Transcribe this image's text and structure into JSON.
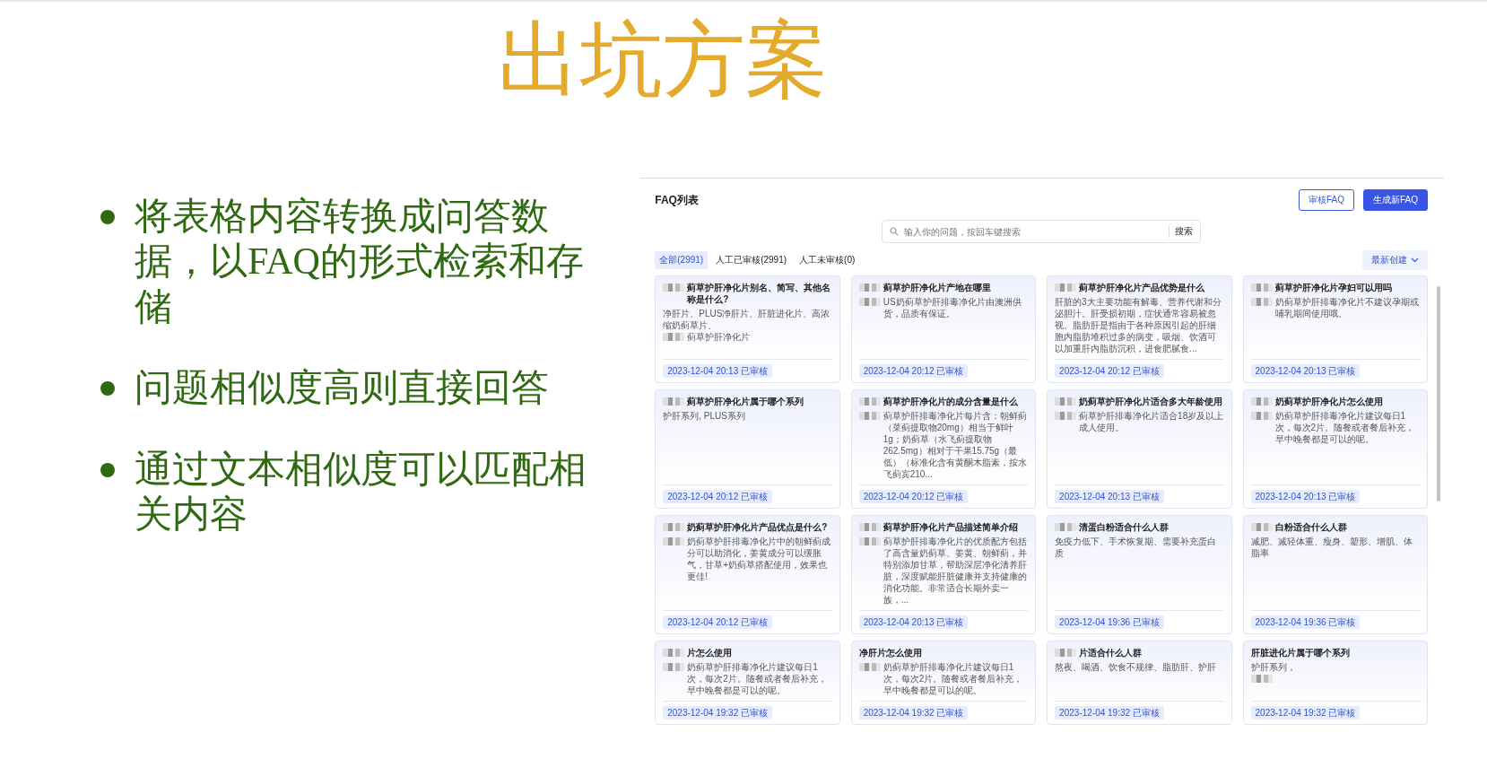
{
  "slide": {
    "title": "出坑方案",
    "bullets": [
      "将表格内容转换成问答数据，以FAQ的形式检索和存储",
      "问题相似度高则直接回答",
      "通过文本相似度可以匹配相关内容"
    ]
  },
  "faq_panel": {
    "title": "FAQ列表",
    "buttons": [
      {
        "label": "审核FAQ",
        "kind": "outline"
      },
      {
        "label": "生成新FAQ",
        "kind": "primary"
      }
    ],
    "search": {
      "placeholder": "输入你的问题，按回车键搜索",
      "button": "搜索"
    },
    "tabs": [
      {
        "label": "全部(2991)",
        "selected": true
      },
      {
        "label": "人工已审核(2991)",
        "selected": false
      },
      {
        "label": "人工未审核(0)",
        "selected": false
      }
    ],
    "sort": {
      "label": "最新创建"
    },
    "cards": [
      {
        "title": [
          {
            "redacted": true,
            "text": "蓟草护肝净化片别名、简写、其他名称是什么?"
          }
        ],
        "answer": [
          {
            "redacted": false,
            "text": "净肝片、PLUS净肝片、肝脏进化片、高浓缩奶蓟草片、"
          },
          {
            "redacted": true,
            "text": "蓟草护肝净化片"
          }
        ],
        "date": "2023-12-04 20:13",
        "status": "已审核"
      },
      {
        "title": [
          {
            "redacted": true,
            "text": "蓟草护肝净化片产地在哪里"
          }
        ],
        "answer": [
          {
            "redacted": true,
            "text": "US奶蓟草护肝排毒净化片由澳洲供货，品质有保证。"
          }
        ],
        "date": "2023-12-04 20:12",
        "status": "已审核"
      },
      {
        "title": [
          {
            "redacted": true,
            "text": "蓟草护肝净化片产品优势是什么"
          }
        ],
        "answer": [
          {
            "redacted": false,
            "text": "肝脏的3大主要功能有解毒、营养代谢和分泌胆汁。肝受损初期，症状通常容易被忽视。脂肪肝是指由于各种原因引起的肝细胞内脂肪堆积过多的病变，吸烟、饮酒可以加重肝内脂肪沉积，进食肥腻食..."
          }
        ],
        "date": "2023-12-04 20:12",
        "status": "已审核"
      },
      {
        "title": [
          {
            "redacted": true,
            "text": "蓟草护肝净化片孕妇可以用吗"
          }
        ],
        "answer": [
          {
            "redacted": true,
            "text": "奶蓟草护肝排毒净化片不建议孕期或哺乳期间使用哦。"
          }
        ],
        "date": "2023-12-04 20:13",
        "status": "已审核"
      },
      {
        "title": [
          {
            "redacted": true,
            "text": "蓟草护肝净化片属于哪个系列"
          }
        ],
        "answer": [
          {
            "redacted": false,
            "text": "护肝系列, PLUS系列"
          }
        ],
        "date": "2023-12-04 20:12",
        "status": "已审核"
      },
      {
        "title": [
          {
            "redacted": true,
            "text": "蓟草护肝净化片的成分含量是什么"
          }
        ],
        "answer": [
          {
            "redacted": true,
            "text": "蓟草护肝排毒净化片每片含：朝鲜蓟（菜蓟提取物20mg）相当于鲜叶1g；奶蓟草（水飞蓟提取物262.5mg）相对于干果15.75g（最低）（标准化含有黄酮木脂素，按水飞蓟宾210..."
          }
        ],
        "date": "2023-12-04 20:12",
        "status": "已审核"
      },
      {
        "title": [
          {
            "redacted": true,
            "text": "奶蓟草护肝净化片适合多大年龄使用"
          }
        ],
        "answer": [
          {
            "redacted": true,
            "text": "蓟草护肝排毒净化片适合18岁及以上成人使用。"
          }
        ],
        "date": "2023-12-04 20:13",
        "status": "已审核"
      },
      {
        "title": [
          {
            "redacted": true,
            "text": "奶蓟草护肝净化片怎么使用"
          }
        ],
        "answer": [
          {
            "redacted": true,
            "text": "奶蓟草护肝排毒净化片建议每日1次，每次2片。随餐或者餐后补充，早中晚餐都是可以的呢。"
          }
        ],
        "date": "2023-12-04 20:13",
        "status": "已审核"
      },
      {
        "title": [
          {
            "redacted": true,
            "text": "奶蓟草护肝净化片产品优点是什么?"
          }
        ],
        "answer": [
          {
            "redacted": true,
            "text": "奶蓟草护肝排毒净化片中的朝鲜蓟成分可以助消化，姜黄成分可以缓胀气，甘草+奶蓟草搭配使用，效果也更佳!"
          }
        ],
        "date": "2023-12-04 20:12",
        "status": "已审核"
      },
      {
        "title": [
          {
            "redacted": true,
            "text": "蓟草护肝净化片产品描述简单介绍"
          }
        ],
        "answer": [
          {
            "redacted": true,
            "text": "蓟草护肝排毒净化片的优质配方包括了高含量奶蓟草、姜黄、朝鲜蓟，并特别添加甘草，帮助深层净化清养肝脏，深度赋能肝脏健康并支持健康的消化功能。非常适合长期外卖一族，..."
          }
        ],
        "date": "2023-12-04 20:13",
        "status": "已审核"
      },
      {
        "title": [
          {
            "redacted": true,
            "text": "清蛋白粉适合什么人群"
          }
        ],
        "answer": [
          {
            "redacted": false,
            "text": "免疫力低下、手术恢复期、需要补充蛋白质"
          }
        ],
        "date": "2023-12-04 19:36",
        "status": "已审核"
      },
      {
        "title": [
          {
            "redacted": true,
            "text": "白粉适合什么人群"
          }
        ],
        "answer": [
          {
            "redacted": false,
            "text": "减肥、减轻体重、瘦身、塑形、增肌、体脂率"
          }
        ],
        "date": "2023-12-04 19:36",
        "status": "已审核"
      },
      {
        "title": [
          {
            "redacted": true,
            "text": "片怎么使用"
          }
        ],
        "answer": [
          {
            "redacted": true,
            "text": "奶蓟草护肝排毒净化片建议每日1次，每次2片。随餐或者餐后补充，早中晚餐都是可以的呢。"
          }
        ],
        "date": "2023-12-04 19:32",
        "status": "已审核"
      },
      {
        "title": [
          {
            "redacted": false,
            "text": "净肝片怎么使用"
          }
        ],
        "answer": [
          {
            "redacted": true,
            "text": "奶蓟草护肝排毒净化片建议每日1次，每次2片。随餐或者餐后补充，早中晚餐都是可以的呢。"
          }
        ],
        "date": "2023-12-04 19:32",
        "status": "已审核"
      },
      {
        "title": [
          {
            "redacted": true,
            "text": "片适合什么人群"
          }
        ],
        "answer": [
          {
            "redacted": false,
            "text": "熬夜、喝酒、饮食不规律、脂肪肝、护肝"
          }
        ],
        "date": "2023-12-04 19:32",
        "status": "已审核"
      },
      {
        "title": [
          {
            "redacted": false,
            "text": "肝脏进化片属于哪个系列"
          }
        ],
        "answer": [
          {
            "redacted": false,
            "text": "护肝系列，"
          },
          {
            "redacted": true
          }
        ],
        "date": "2023-12-04 19:32",
        "status": "已审核"
      }
    ]
  }
}
